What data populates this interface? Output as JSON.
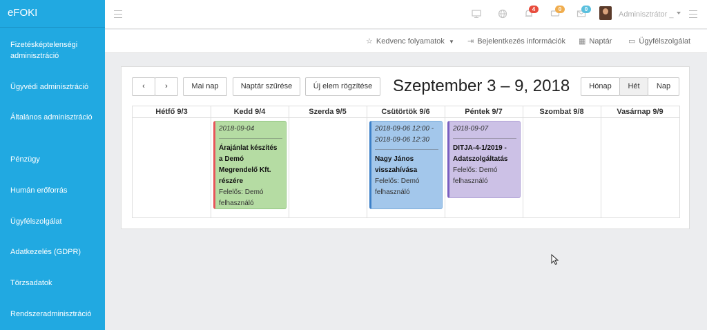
{
  "app": {
    "brand": "eFOKI"
  },
  "sidebar": {
    "items": [
      {
        "label": "Fizetésképtelenségi adminisztráció"
      },
      {
        "label": "Ügyvédi adminisztráció"
      },
      {
        "label": "Általános adminisztráció"
      },
      {
        "label": "Pénzügy"
      },
      {
        "label": "Humán erőforrás"
      },
      {
        "label": "Ügyfélszolgálat"
      },
      {
        "label": "Adatkezelés (GDPR)"
      },
      {
        "label": "Törzsadatok"
      },
      {
        "label": "Rendszeradminisztráció"
      }
    ]
  },
  "topbar": {
    "badges": {
      "bell": "4",
      "messages": "0",
      "inbox": "0"
    },
    "badge_colors": {
      "bell": "#e84c3d",
      "messages": "#f0ad4e",
      "inbox": "#5bc0de"
    },
    "user_name": "Adminisztrátor _"
  },
  "subbar": {
    "favorites": "Kedvenc folyamatok",
    "login_info": "Bejelentkezés információk",
    "calendar": "Naptár",
    "support": "Ügyfélszolgálat"
  },
  "calendar": {
    "prev": "‹",
    "next": "›",
    "today": "Mai nap",
    "filter": "Naptár szűrése",
    "new_item": "Új elem rögzítése",
    "title": "Szeptember 3 – 9, 2018",
    "views": {
      "month": "Hónap",
      "week": "Hét",
      "day": "Nap"
    },
    "active_view": "Hét",
    "days": [
      "Hétfő 9/3",
      "Kedd 9/4",
      "Szerda 9/5",
      "Csütörtök 9/6",
      "Péntek 9/7",
      "Szombat 9/8",
      "Vasárnap 9/9"
    ],
    "events": [
      {
        "time": "2018-09-04",
        "title": "Árajánlat készítés a Demó Megrendelő Kft. részére",
        "owner": "Felelős: Demó felhasználó",
        "color": "#b5dca3"
      },
      {
        "time": "2018-09-06 12:00 - 2018-09-06 12:30",
        "title": "Nagy János visszahívása",
        "owner": "Felelős: Demó felhasználó",
        "color": "#a3c7eb"
      },
      {
        "time": "2018-09-07",
        "title": "DITJA-4-1/2019 - Adatszolgáltatás",
        "owner": "Felelős: Demó felhasználó",
        "color": "#ccc1e6"
      }
    ]
  }
}
